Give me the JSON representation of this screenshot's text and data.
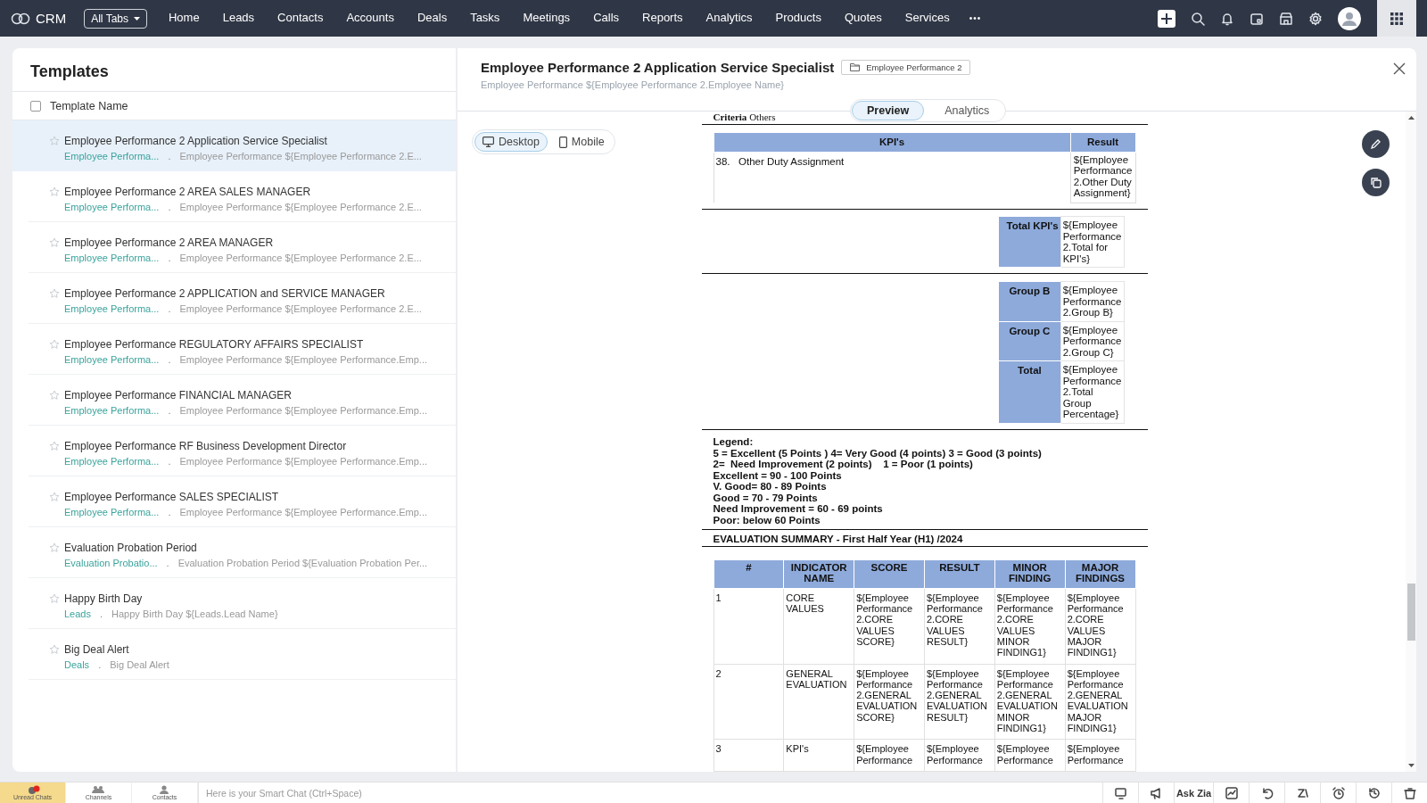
{
  "top_nav": {
    "logo": "CRM",
    "all_tabs": "All Tabs",
    "more": "•••",
    "tabs": [
      {
        "label": "Home",
        "selected": false
      },
      {
        "label": "Leads",
        "selected": false
      },
      {
        "label": "Contacts",
        "selected": false
      },
      {
        "label": "Accounts",
        "selected": false
      },
      {
        "label": "Deals",
        "selected": false
      },
      {
        "label": "Tasks",
        "selected": false
      },
      {
        "label": "Meetings",
        "selected": false
      },
      {
        "label": "Calls",
        "selected": false
      },
      {
        "label": "Reports",
        "selected": false
      },
      {
        "label": "Analytics",
        "selected": false
      },
      {
        "label": "Products",
        "selected": false
      },
      {
        "label": "Quotes",
        "selected": false
      },
      {
        "label": "Services",
        "selected": false
      }
    ]
  },
  "templates": {
    "title": "Templates",
    "column": "Template Name",
    "select_all_checked": false,
    "separator": ".",
    "items": [
      {
        "name": "Employee Performance 2 Application Service Specialist",
        "module": "Employee Performa...",
        "subject": "Employee Performance ${Employee Performance 2.E...",
        "selected": true,
        "starred": false
      },
      {
        "name": "Employee Performance 2 AREA SALES MANAGER",
        "module": "Employee Performa...",
        "subject": "Employee Performance ${Employee Performance 2.E...",
        "selected": false,
        "starred": false
      },
      {
        "name": "Employee Performance 2 AREA MANAGER",
        "module": "Employee Performa...",
        "subject": "Employee Performance ${Employee Performance 2.E...",
        "selected": false,
        "starred": false
      },
      {
        "name": "Employee Performance 2 APPLICATION and SERVICE MANAGER",
        "module": "Employee Performa...",
        "subject": "Employee Performance ${Employee Performance 2.E...",
        "selected": false,
        "starred": false
      },
      {
        "name": "Employee Performance REGULATORY AFFAIRS SPECIALIST",
        "module": "Employee Performa...",
        "subject": "Employee Performance ${Employee Performance.Emp...",
        "selected": false,
        "starred": false
      },
      {
        "name": "Employee Performance FINANCIAL MANAGER",
        "module": "Employee Performa...",
        "subject": "Employee Performance ${Employee Performance.Emp...",
        "selected": false,
        "starred": false
      },
      {
        "name": "Employee Performance RF Business Development Director",
        "module": "Employee Performa...",
        "subject": "Employee Performance ${Employee Performance.Emp...",
        "selected": false,
        "starred": false
      },
      {
        "name": "Employee Performance SALES SPECIALIST",
        "module": "Employee Performa...",
        "subject": "Employee Performance ${Employee Performance.Emp...",
        "selected": false,
        "starred": false
      },
      {
        "name": "Evaluation Probation Period",
        "module": "Evaluation Probatio...",
        "subject": "Evaluation Probation Period ${Evaluation Probation Per...",
        "selected": false,
        "starred": false
      },
      {
        "name": "Happy Birth Day",
        "module": "Leads",
        "subject": "Happy Birth Day ${Leads.Lead Name}",
        "selected": false,
        "starred": false
      },
      {
        "name": "Big Deal Alert",
        "module": "Deals",
        "subject": "Big Deal Alert",
        "selected": false,
        "starred": false
      }
    ]
  },
  "preview": {
    "title": "Employee Performance 2 Application Service Specialist",
    "module_tag": "Employee Performance 2",
    "subject": "Employee Performance ${Employee Performance 2.Employee Name}",
    "view_tabs": [
      {
        "label": "Preview",
        "selected": true
      },
      {
        "label": "Analytics",
        "selected": false
      }
    ],
    "devices": [
      {
        "label": "Desktop",
        "selected": true
      },
      {
        "label": "Mobile",
        "selected": false
      }
    ],
    "document": {
      "criteria": "**Criteria** Others",
      "kpi_table": {
        "columns": [
          "KPI's",
          "Result"
        ],
        "rows": [
          [
            "38.   Other Duty Assignment",
            "${Employee Performance 2.Other Duty Assignment}"
          ]
        ]
      },
      "total_kpis": [
        {
          "label": "Total KPI's",
          "value": "${Employee Performance 2.Total for KPI's}"
        }
      ],
      "groups": [
        {
          "label": "Group B",
          "value": "${Employee Performance 2.Group B}"
        },
        {
          "label": "Group C",
          "value": "${Employee Performance 2.Group C}"
        },
        {
          "label": "Total",
          "value": "${Employee Performance 2.Total Group Percentage}"
        }
      ],
      "legend": [
        "Legend:",
        "5 = Excellent (5 Points ) 4= Very Good (4 points) 3 = Good (3 points)",
        "2=  Need Improvement (2 points)    1 = Poor (1 points)",
        "Excellent = 90 - 100 Points",
        "V. Good= 80 - 89 Points",
        "Good = 70 - 79 Points",
        "Need Improvement = 60 - 69 points",
        "Poor: below 60 Points"
      ],
      "summary_title": "EVALUATION SUMMARY - First Half Year (H1) /2024",
      "summary_table": {
        "columns": [
          "#",
          "INDICATOR NAME",
          "SCORE",
          "RESULT",
          "MINOR FINDING",
          "MAJOR FINDINGS"
        ],
        "rows": [
          [
            "1",
            "CORE VALUES",
            "${Employee Performance 2.CORE VALUES SCORE}",
            "${Employee Performance 2.CORE VALUES RESULT}",
            "${Employee Performance 2.CORE VALUES MINOR FINDING1}",
            "${Employee Performance 2.CORE VALUES MAJOR FINDING1}"
          ],
          [
            "2",
            "GENERAL EVALUATION",
            "${Employee Performance 2.GENERAL EVALUATION SCORE}",
            "${Employee Performance 2.GENERAL EVALUATION RESULT}",
            "${Employee Performance 2.GENERAL EVALUATION MINOR FINDING1}",
            "${Employee Performance 2.GENERAL EVALUATION MAJOR FINDING1}"
          ],
          [
            "3",
            "KPI's",
            "${Employee Performance",
            "${Employee Performance",
            "${Employee Performance",
            "${Employee Performance"
          ]
        ]
      }
    }
  },
  "bottom_bar": {
    "chat_tabs": [
      {
        "label": "Unread Chats",
        "selected": true
      },
      {
        "label": "Channels",
        "selected": false
      },
      {
        "label": "Contacts",
        "selected": false
      }
    ],
    "smart_chat_placeholder": "Here is your Smart Chat (Ctrl+Space)",
    "ask_zia": "Ask Zia"
  }
}
